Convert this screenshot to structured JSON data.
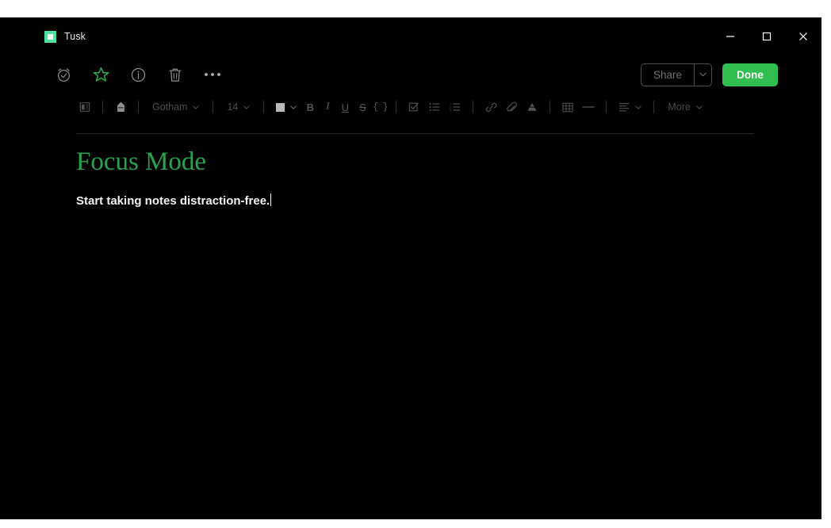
{
  "window": {
    "app_icon": "app-logo-icon",
    "title": "Tusk",
    "controls": {
      "minimize": "minimize-icon",
      "maximize": "maximize-icon",
      "close": "close-icon"
    }
  },
  "action_bar": {
    "icons": [
      {
        "name": "reminder-alarm-icon",
        "label": "Reminder"
      },
      {
        "name": "favorite-star-icon",
        "label": "Favorite"
      },
      {
        "name": "info-icon",
        "label": "Info"
      },
      {
        "name": "trash-icon",
        "label": "Delete"
      },
      {
        "name": "more-options-icon",
        "label": "More options"
      }
    ],
    "share_label": "Share",
    "share_dropdown": "chevron-down-icon",
    "done_label": "Done"
  },
  "format_toolbar": {
    "paragraph_style_icon": "paragraph-style-icon",
    "highlight_icon": "highlighter-icon",
    "font_family": "Gotham",
    "font_size": "14",
    "font_color_swatch": "#b9b9b9",
    "bold": "B",
    "italic": "I",
    "underline": "U",
    "strikethrough": "S",
    "code": "{ }",
    "checklist_icon": "checklist-icon",
    "bullet_list_icon": "bullet-list-icon",
    "numbered_list_icon": "numbered-list-icon",
    "link_icon": "link-icon",
    "attachment_icon": "paperclip-icon",
    "drive_icon": "drive-icon",
    "table_icon": "table-icon",
    "horizontal_rule_icon": "horizontal-rule-icon",
    "align_icon": "align-left-icon",
    "more_label": "More",
    "chevron": "chevron-down-icon"
  },
  "document": {
    "title": "Focus Mode",
    "body": "Start taking notes distraction-free.",
    "title_color": "#29a352"
  },
  "colors": {
    "window_background": "#000000",
    "page_background": "#ffffff",
    "accent_green": "#31bf51",
    "app_icon_green": "#4de39e",
    "toolbar_gray": "#4a4a4a",
    "divider": "#232323"
  }
}
